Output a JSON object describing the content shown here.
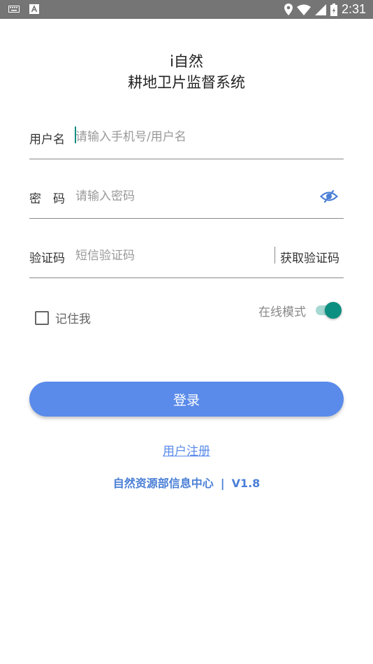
{
  "status_bar": {
    "time": "2:31",
    "left_icons": [
      "keyboard-icon",
      "a-notification-icon"
    ],
    "right_icons": [
      "location-icon",
      "wifi-icon",
      "signal-icon",
      "battery-icon"
    ]
  },
  "app": {
    "title_line1": "i自然",
    "title_line2": "耕地卫片监督系统"
  },
  "form": {
    "username": {
      "label": "用户名",
      "placeholder": "请输入手机号/用户名"
    },
    "password": {
      "label": "密　码",
      "placeholder": "请输入密码",
      "icon": "eye-off-icon"
    },
    "captcha": {
      "label": "验证码",
      "placeholder": "短信验证码",
      "get_code_label": "获取验证码"
    }
  },
  "options": {
    "remember_label": "记住我",
    "remember_checked": false,
    "online_mode_label": "在线模式",
    "online_mode_on": true
  },
  "actions": {
    "login_label": "登录",
    "register_label": "用户注册"
  },
  "footer": {
    "org": "自然资源部信息中心",
    "separator": "|",
    "version": "V1.8"
  },
  "colors": {
    "accent": "#5a8bea",
    "toggle_on": "#0b8f80",
    "status_bar": "#757575"
  }
}
